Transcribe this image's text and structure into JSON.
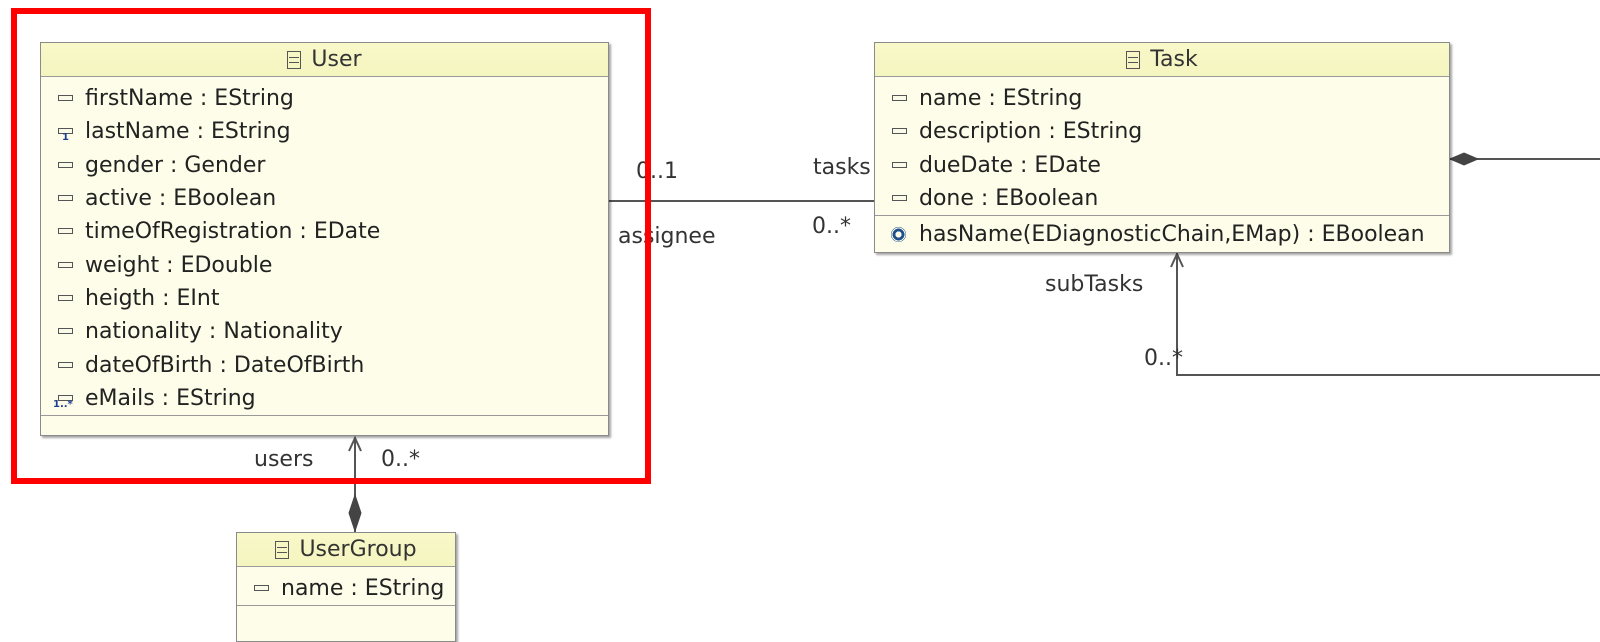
{
  "classes": {
    "user": {
      "name": "User",
      "attributes": [
        {
          "text": "firstName : EString",
          "mult": ""
        },
        {
          "text": "lastName : EString",
          "mult": "1"
        },
        {
          "text": "gender : Gender",
          "mult": ""
        },
        {
          "text": "active : EBoolean",
          "mult": ""
        },
        {
          "text": "timeOfRegistration : EDate",
          "mult": ""
        },
        {
          "text": "weight : EDouble",
          "mult": ""
        },
        {
          "text": "heigth : EInt",
          "mult": ""
        },
        {
          "text": "nationality : Nationality",
          "mult": ""
        },
        {
          "text": "dateOfBirth : DateOfBirth",
          "mult": ""
        },
        {
          "text": "eMails : EString",
          "mult": "1..*"
        }
      ]
    },
    "task": {
      "name": "Task",
      "attributes": [
        {
          "text": "name : EString"
        },
        {
          "text": "description : EString"
        },
        {
          "text": "dueDate : EDate"
        },
        {
          "text": "done : EBoolean"
        }
      ],
      "operations": [
        {
          "text": "hasName(EDiagnosticChain,EMap) : EBoolean"
        }
      ]
    },
    "usergroup": {
      "name": "UserGroup",
      "attributes": [
        {
          "text": "name : EString"
        }
      ]
    }
  },
  "associations": {
    "user_task": {
      "assignee_mult": "0..1",
      "assignee_role": "assignee",
      "tasks_role": "tasks",
      "tasks_mult": "0..*"
    },
    "group_users": {
      "role": "users",
      "mult": "0..*"
    },
    "task_subtasks": {
      "role": "subTasks",
      "mult": "0..*"
    }
  },
  "colors": {
    "highlight": "#ff0000",
    "class_fill": "#fdfde9",
    "class_header": "#f7f7c6",
    "multiplicity_icon": "#1c3f94"
  },
  "icons": {
    "class": "eclass-icon",
    "attribute": "eattribute-icon",
    "operation": "eoperation-icon"
  }
}
